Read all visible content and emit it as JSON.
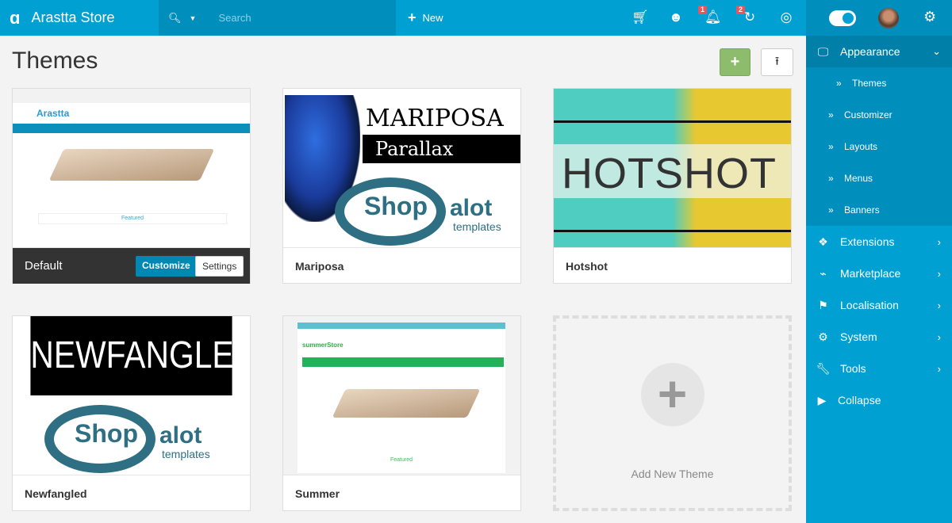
{
  "topbar": {
    "brand": "Arastta Store",
    "search_placeholder": "Search",
    "new_label": "New",
    "notifications_count": "1",
    "updates_count": "2"
  },
  "page": {
    "title": "Themes"
  },
  "themes": [
    {
      "name": "Default",
      "customize_label": "Customize",
      "settings_label": "Settings",
      "active": true,
      "preview": {
        "logo": "Arastta",
        "featured": "Featured"
      }
    },
    {
      "name": "Mariposa",
      "preview": {
        "title": "MARIPOSA",
        "subtitle": "Parallax",
        "shop": "Shop",
        "alot": "alot",
        "templates": "templates"
      }
    },
    {
      "name": "Hotshot",
      "preview": {
        "title": "HOTSHOT"
      }
    },
    {
      "name": "Newfangled",
      "preview": {
        "title": "NEWFANGLED",
        "shop": "Shop",
        "alot": "alot",
        "templates": "templates"
      }
    },
    {
      "name": "Summer",
      "preview": {
        "logo": "summerStore",
        "featured": "Featured"
      }
    }
  ],
  "add_new_theme": "Add New Theme",
  "sidebar": {
    "items": [
      {
        "label": "Appearance",
        "icon": "desktop-icon",
        "expanded": true
      },
      {
        "label": "Extensions",
        "icon": "puzzle-icon"
      },
      {
        "label": "Marketplace",
        "icon": "plug-icon"
      },
      {
        "label": "Localisation",
        "icon": "flag-icon"
      },
      {
        "label": "System",
        "icon": "gear-icon"
      },
      {
        "label": "Tools",
        "icon": "wrench-icon"
      },
      {
        "label": "Collapse",
        "icon": "play-circle-icon"
      }
    ],
    "appearance_sub": [
      "Themes",
      "Customizer",
      "Layouts",
      "Menus",
      "Banners"
    ]
  },
  "colors": {
    "topbar": "#00a0d2",
    "sidebar": "#00a0d2",
    "add_button": "#8cbc6c",
    "customize_button": "#0088b5",
    "badge": "#e8555a"
  }
}
